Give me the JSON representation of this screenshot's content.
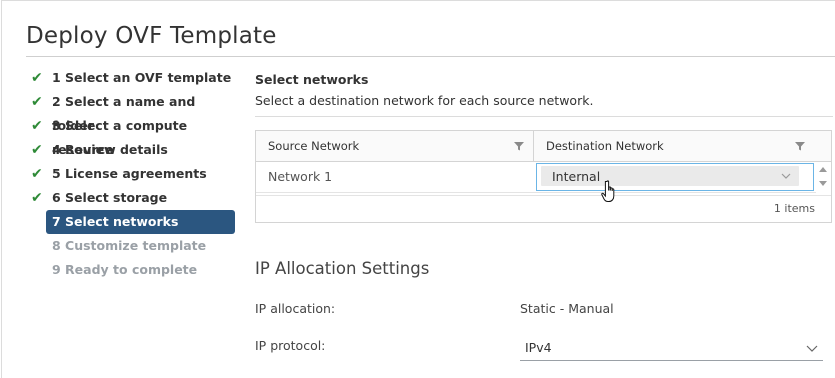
{
  "dialog": {
    "title": "Deploy OVF Template"
  },
  "steps": [
    {
      "label": "1 Select an OVF template",
      "state": "done"
    },
    {
      "label": "2 Select a name and folder",
      "state": "done"
    },
    {
      "label": "3 Select a compute resource",
      "state": "done"
    },
    {
      "label": "4 Review details",
      "state": "done"
    },
    {
      "label": "5 License agreements",
      "state": "done"
    },
    {
      "label": "6 Select storage",
      "state": "done"
    },
    {
      "label": "7 Select networks",
      "state": "active"
    },
    {
      "label": "8 Customize template",
      "state": "disabled"
    },
    {
      "label": "9 Ready to complete",
      "state": "disabled"
    }
  ],
  "networks": {
    "title": "Select networks",
    "subtitle": "Select a destination network for each source network.",
    "columns": [
      "Source Network",
      "Destination Network"
    ],
    "rows": [
      {
        "source": "Network 1",
        "destination": "Internal"
      }
    ],
    "footer": "1 items"
  },
  "ip_settings": {
    "title": "IP Allocation Settings",
    "allocation_label": "IP allocation:",
    "allocation_value": "Static - Manual",
    "protocol_label": "IP protocol:",
    "protocol_value": "IPv4"
  },
  "colors": {
    "active_step_bg": "#2b5680",
    "check_green": "#2e8a37",
    "focus_border": "#6bb5e6"
  }
}
